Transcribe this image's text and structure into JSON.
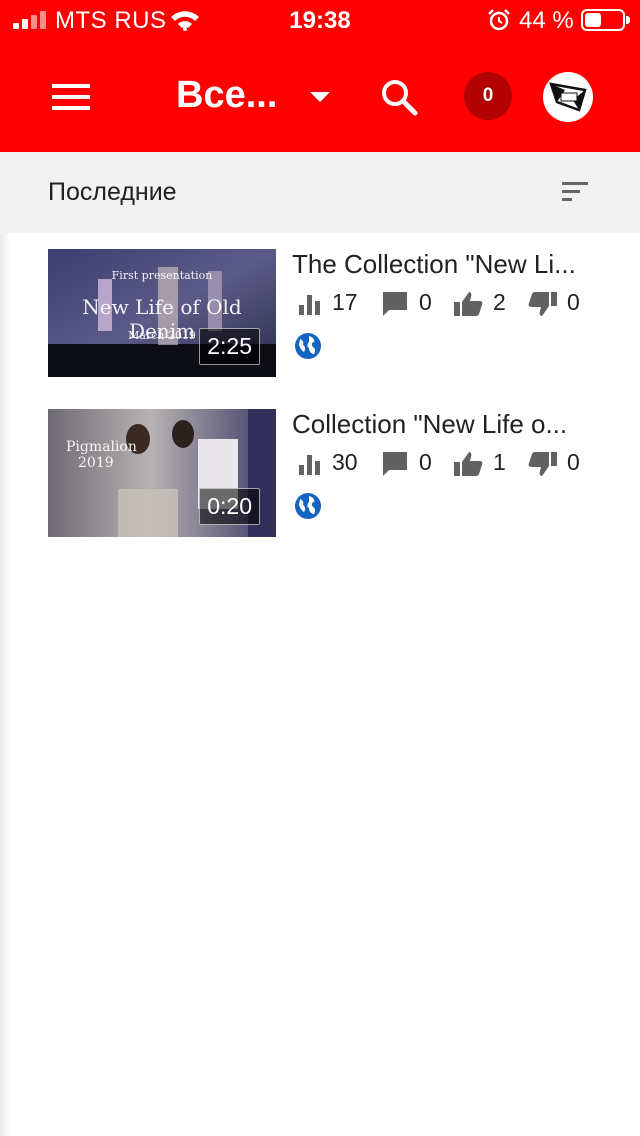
{
  "status_bar": {
    "carrier": "MTS RUS",
    "time": "19:38",
    "battery_percent": "44 %",
    "battery_level": 0.44
  },
  "app_bar": {
    "title": "Все...",
    "notification_count": "0",
    "icons": [
      "menu-icon",
      "dropdown-arrow-icon",
      "search-icon",
      "avatar"
    ]
  },
  "sort_bar": {
    "title": "Последние",
    "icon": "sort-icon"
  },
  "videos": [
    {
      "title": "The Collection \"New Li...",
      "duration": "2:25",
      "views": "17",
      "comments": "0",
      "likes": "2",
      "dislikes": "0",
      "visibility_icon": "globe-icon",
      "thumbnail_text": {
        "line1": "First presentation",
        "line2": "New Life of Old Denim",
        "line3": "March 2019"
      }
    },
    {
      "title": "Collection \"New Life o...",
      "duration": "0:20",
      "views": "30",
      "comments": "0",
      "likes": "1",
      "dislikes": "0",
      "visibility_icon": "globe-icon",
      "thumbnail_text": {
        "line1": "Pigmalion",
        "line2": "2019"
      }
    }
  ],
  "colors": {
    "brand_red": "#ff0000",
    "badge_red": "#b30000",
    "icon_gray": "#616161",
    "globe_blue": "#1565c0"
  }
}
